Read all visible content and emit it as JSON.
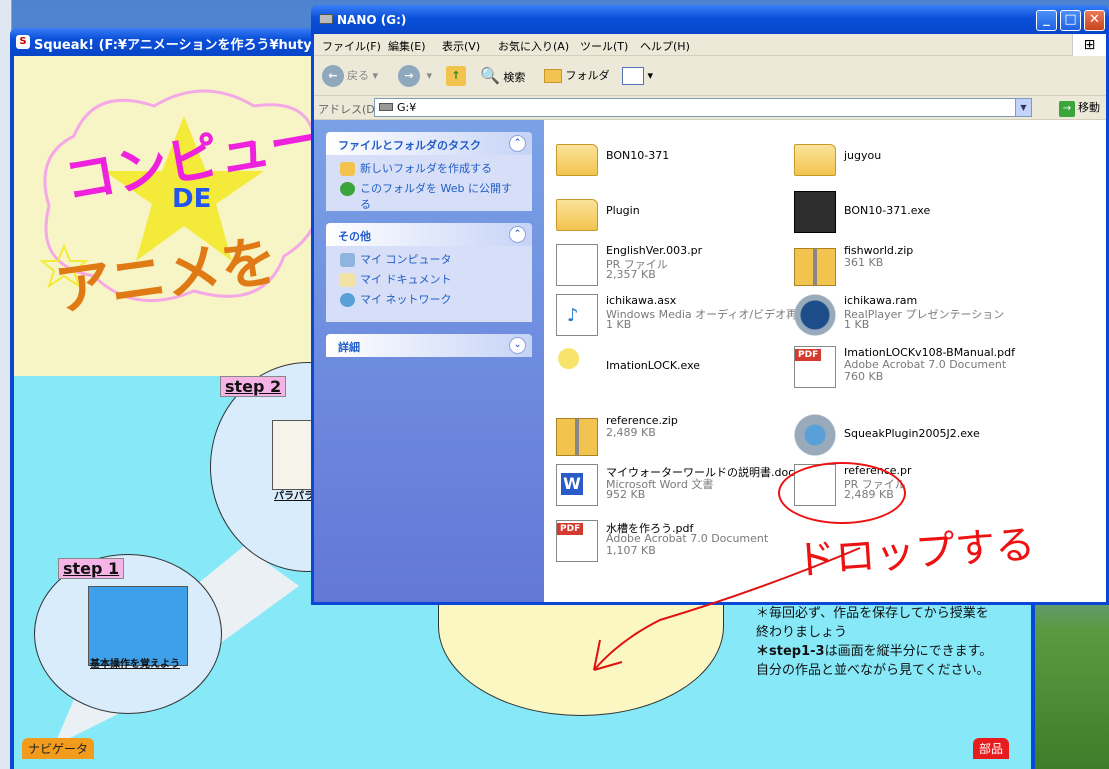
{
  "squeak": {
    "title": "Squeak! (F:¥アニメーションを作ろう¥hutyuhiga",
    "title_text_line1": "コンピュー",
    "title_text_de": "DE",
    "title_text_line2": "アニメを",
    "step1": {
      "label": "step 1",
      "caption": "基本操作を覚えよう"
    },
    "step2": {
      "label": "step 2",
      "caption": "パラパラ"
    },
    "info_line1": "＊毎回必ず、作品を保存してから授業を",
    "info_line2": "終わりましょう",
    "info_line3_bold": "＊step1-3",
    "info_line3_rest": "は画面を縦半分にできます。",
    "info_line4": "自分の作品と並べながら見てください。",
    "navigator_label": "ナビゲータ",
    "parts_label": "部品"
  },
  "explorer": {
    "title": "NANO (G:)",
    "menu": [
      "ファイル(F)",
      "編集(E)",
      "表示(V)",
      "お気に入り(A)",
      "ツール(T)",
      "ヘルプ(H)"
    ],
    "toolbar": {
      "back": "戻る",
      "search": "検索",
      "folder": "フォルダ"
    },
    "address_label": "アドレス(D)",
    "address_value": "G:¥",
    "go_label": "移動",
    "panels": {
      "tasks": {
        "title": "ファイルとフォルダのタスク",
        "links": [
          "新しいフォルダを作成する",
          "このフォルダを Web に公開する"
        ]
      },
      "other": {
        "title": "その他",
        "links": [
          "マイ コンピュータ",
          "マイ ドキュメント",
          "マイ ネットワーク"
        ]
      },
      "details": {
        "title": "詳細"
      }
    },
    "files": [
      {
        "name": "BON10-371",
        "type": "",
        "size": "",
        "icon": "folder-icon"
      },
      {
        "name": "jugyou",
        "type": "",
        "size": "",
        "icon": "folder-icon"
      },
      {
        "name": "Plugin",
        "type": "",
        "size": "",
        "icon": "folder-icon"
      },
      {
        "name": "BON10-371.exe",
        "type": "",
        "size": "",
        "icon": "exe-icon"
      },
      {
        "name": "EnglishVer.003.pr",
        "type": "PR ファイル",
        "size": "2,357 KB",
        "icon": "pr-file-icon"
      },
      {
        "name": "fishworld.zip",
        "type": "",
        "size": "361 KB",
        "icon": "zip-icon"
      },
      {
        "name": "ichikawa.asx",
        "type": "Windows Media オーディオ/ビデオ再...",
        "size": "1 KB",
        "icon": "media-icon"
      },
      {
        "name": "ichikawa.ram",
        "type": "RealPlayer プレゼンテーション",
        "size": "1 KB",
        "icon": "realplayer-icon"
      },
      {
        "name": "ImationLOCK.exe",
        "type": "",
        "size": "",
        "icon": "key-icon"
      },
      {
        "name": "ImationLOCKv108-BManual.pdf",
        "type": "Adobe Acrobat 7.0 Document",
        "size": "760 KB",
        "icon": "pdf-icon"
      },
      {
        "name": "reference.zip",
        "type": "",
        "size": "2,489 KB",
        "icon": "zip-icon"
      },
      {
        "name": "SqueakPlugin2005J2.exe",
        "type": "",
        "size": "",
        "icon": "squeak-installer-icon"
      },
      {
        "name": "マイウォーターワールドの説明書.doc",
        "type": "Microsoft Word 文書",
        "size": "952 KB",
        "icon": "word-icon"
      },
      {
        "name": "reference.pr",
        "type": "PR ファイル",
        "size": "2,489 KB",
        "icon": "pr-file-icon"
      },
      {
        "name": "水槽を作ろう.pdf",
        "type": "Adobe Acrobat 7.0 Document",
        "size": "1,107 KB",
        "icon": "pdf-icon"
      }
    ]
  },
  "annotation": {
    "text": "ドロップする",
    "color": "#e11111"
  }
}
